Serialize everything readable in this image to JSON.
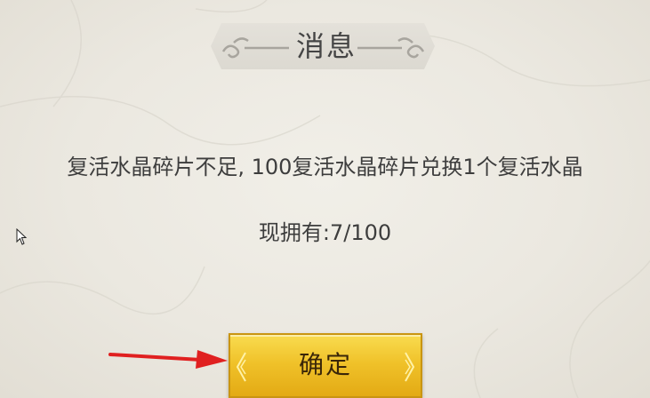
{
  "dialog": {
    "title": "消息",
    "message": "复活水晶碎片不足, 100复活水晶碎片兑换1个复活水晶",
    "stock": "现拥有:7/100",
    "confirm_label": "确定"
  },
  "icons": {
    "title_ornament_left": "cloud-scroll-ornament",
    "title_ornament_right": "cloud-scroll-ornament",
    "pointer": "mouse-cursor",
    "annotation": "red-arrow"
  },
  "colors": {
    "background": "#ebe8e0",
    "text": "#3d3d3d",
    "button": "#f0c22a",
    "arrow": "#e02020"
  }
}
